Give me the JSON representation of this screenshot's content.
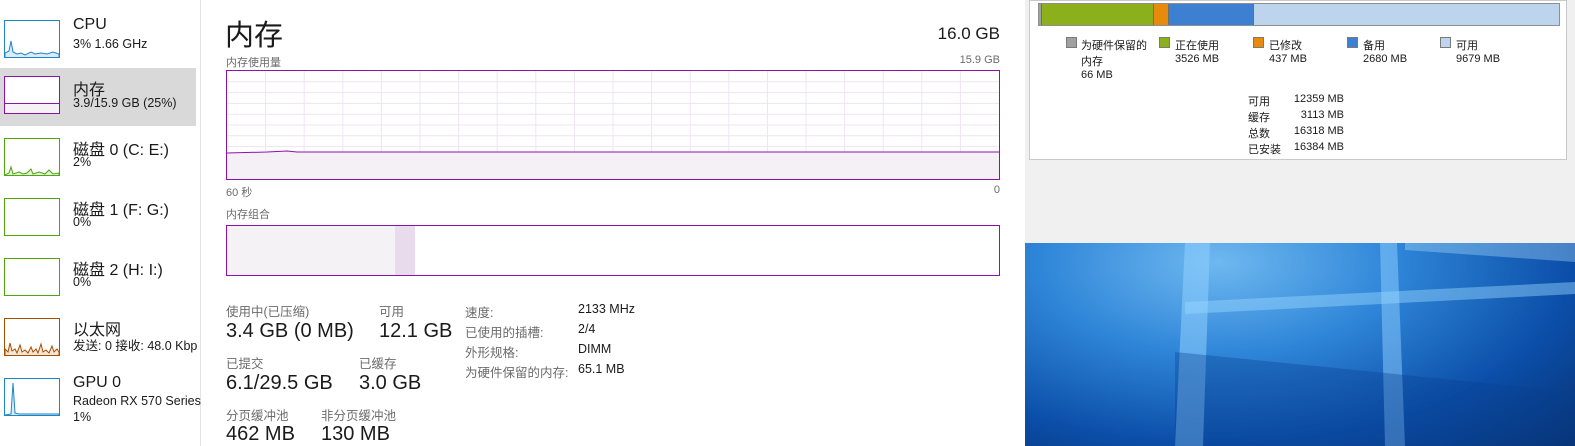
{
  "sidebar": {
    "items": [
      {
        "title": "CPU",
        "sub": "3% 1.66 GHz",
        "color": "#1b86c6"
      },
      {
        "title": "内存",
        "sub": "3.9/15.9 GB (25%)",
        "color": "#8b12ae"
      },
      {
        "title": "磁盘 0 (C: E:)",
        "sub": "2%",
        "color": "#4da60c"
      },
      {
        "title": "磁盘 1 (F: G:)",
        "sub": "0%",
        "color": "#4da60c"
      },
      {
        "title": "磁盘 2 (H: I:)",
        "sub": "0%",
        "color": "#4da60c"
      },
      {
        "title": "以太网",
        "sub": "发送: 0 接收: 48.0 Kbp",
        "color": "#a74f01"
      },
      {
        "title": "GPU 0",
        "sub": "Radeon RX 570 Series",
        "sub2": "1%",
        "color": "#1b86c6"
      }
    ]
  },
  "main": {
    "title": "内存",
    "total": "16.0 GB",
    "usage_label": "内存使用量",
    "usage_max": "15.9 GB",
    "time_left": "60 秒",
    "time_right": "0",
    "composition_label": "内存组合",
    "usage_fraction": 0.25,
    "stats": {
      "in_use_label": "使用中(已压缩)",
      "in_use_value": "3.4 GB (0 MB)",
      "available_label": "可用",
      "available_value": "12.1 GB",
      "committed_label": "已提交",
      "committed_value": "6.1/29.5 GB",
      "cached_label": "已缓存",
      "cached_value": "3.0 GB",
      "paged_label": "分页缓冲池",
      "paged_value": "462 MB",
      "nonpaged_label": "非分页缓冲池",
      "nonpaged_value": "130 MB"
    },
    "details": [
      {
        "label": "速度:",
        "value": "2133 MHz"
      },
      {
        "label": "已使用的插槽:",
        "value": "2/4"
      },
      {
        "label": "外形规格:",
        "value": "DIMM"
      },
      {
        "label": "为硬件保留的内存:",
        "value": "65.1 MB"
      }
    ]
  },
  "resource_monitor": {
    "bar_mb": {
      "reserved": 66,
      "in_use": 3526,
      "modified": 437,
      "standby": 2680,
      "free": 9679
    },
    "legend": {
      "reserved_label_1": "为硬件保留的",
      "reserved_label_2": "内存",
      "reserved_value": "66 MB",
      "in_use_label": "正在使用",
      "in_use_value": "3526 MB",
      "modified_label": "已修改",
      "modified_value": "437 MB",
      "standby_label": "备用",
      "standby_value": "2680 MB",
      "free_label": "可用",
      "free_value": "9679 MB"
    },
    "summary": [
      {
        "label": "可用",
        "value": "12359 MB"
      },
      {
        "label": "缓存",
        "value": "3113 MB"
      },
      {
        "label": "总数",
        "value": "16318 MB"
      },
      {
        "label": "已安装",
        "value": "16384 MB"
      }
    ],
    "colors": {
      "reserved": "#a0a0a0",
      "in_use": "#8bb01c",
      "modified": "#e88a0c",
      "standby": "#3d7fd0",
      "free": "#bcd4ee"
    }
  }
}
